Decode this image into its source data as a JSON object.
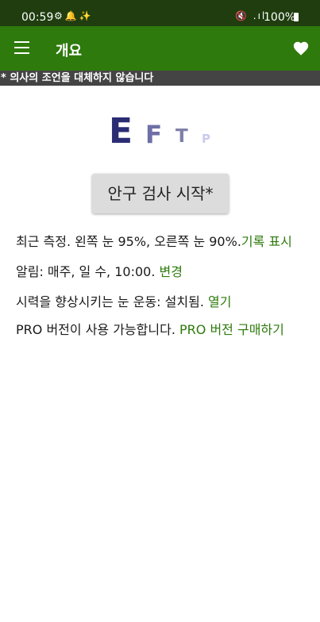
{
  "status_bar": {
    "time": "00:59",
    "battery": "100%",
    "left_icons": "⚙🔔✨",
    "right_icons": "🔇 .ıl"
  },
  "app_bar": {
    "title": "개요"
  },
  "disclaimer": "* 의사의 조언을 대체하지 않습니다",
  "eye_chart": {
    "letters": [
      "E",
      "F",
      "T",
      "P"
    ]
  },
  "start_button_label": "안구 검사 시작*",
  "rows": {
    "recent_text": "최근 측정. 왼쪽 눈 95%, 오른쪽 눈 90%.",
    "recent_link": "기록 표시",
    "alarm_text": "알림: 매주, 일 수, 10:00. ",
    "alarm_link": "변경",
    "exercise_text": "시력을 향상시키는 눈 운동: 설치됨. ",
    "exercise_link": "열기",
    "pro_text": "PRO 버전이 사용 가능합니다. ",
    "pro_link": "PRO 버전 구매하기"
  },
  "colors": {
    "status_bar": "#1f3d0f",
    "app_bar": "#2e7a0c",
    "link": "#2e7a0c",
    "disclaimer_bg": "#444444"
  }
}
